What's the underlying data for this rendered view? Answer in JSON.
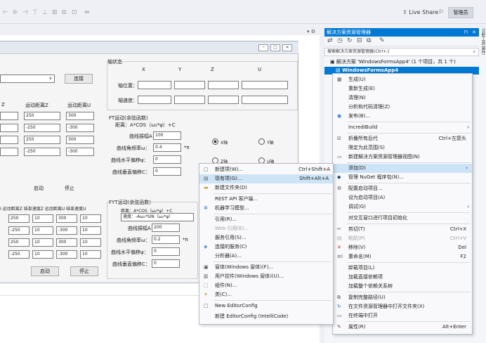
{
  "toolbar": {
    "icons": [
      "align-left-icon",
      "align-center-icon",
      "align-right-icon",
      "align-top-icon",
      "align-middle-icon",
      "align-bottom-icon",
      "same-size-icon",
      "grid-icon",
      "spacing-icon"
    ],
    "live_share": "Live Share",
    "admin": "管理员",
    "pin_icon": "pin-icon",
    "close_icon": "close-icon"
  },
  "form": {
    "connect_btn": "连接",
    "axis_state": "轴状态",
    "axis_cols": [
      "X",
      "Y",
      "Z",
      "U"
    ],
    "axis_pos": "轴位置：",
    "axis_speed": "轴速度：",
    "col_headers": [
      "Z",
      "运动距离Z",
      "运动距离U"
    ],
    "grid_values": [
      [
        "250",
        "300"
      ],
      [
        "-250",
        "-300"
      ],
      [
        "250",
        "300"
      ],
      [
        "-250",
        "-300"
      ]
    ],
    "start": "启动",
    "stop": "停止",
    "ft_title": "FT运动(余弦函数)",
    "ft_formula": "距离：A*COS（ω₂*ψ）+C",
    "ft_amp": "曲线振幅A：",
    "ft_amp_val": "100",
    "ft_freq": "曲线角频率ω：",
    "ft_freq_val": "0.4",
    "ft_pi": "*π",
    "ft_h": "曲线水平偏移ψ：",
    "ft_h_val": "0",
    "ft_v": "曲线垂直偏移C：",
    "ft_v_val": "0",
    "radio_x": "X轴",
    "radio_y": "Y轴",
    "radio_z": "Z轴",
    "radio_u": "U轴",
    "lower_headers": "I 运动距离Z 结束速度Z 运动距离U 结束速度U",
    "lower_rows": [
      [
        "250",
        "10",
        "300",
        "10"
      ],
      [
        "-250",
        "10",
        "-300",
        "10"
      ],
      [
        "250",
        "10",
        "300",
        "10"
      ],
      [
        "-250",
        "10",
        "-300",
        "10"
      ]
    ],
    "fyt_title": "FYT运动(余弦函数)",
    "fyt_dist": "距离：A*COS（ω₂*ψ）+C",
    "fyt_speed": "速度：-Aω₂*SIN（ω₂*ψ）",
    "fyt_amp_val": "200",
    "fyt_freq_val": "0.2",
    "fyt_h_val": "0",
    "fyt_v_val": "0"
  },
  "solution": {
    "title": "解决方案资源管理器",
    "search_placeholder": "搜索解决方案资源管理器(Ctrl+;)",
    "row1": "解决方案 'WindowsFormsApp4' (1 个项目，共 1 个)",
    "row2": "WindowsFormsApp4",
    "side_tabs": "诊断工具  属性"
  },
  "context_menu": {
    "items": [
      {
        "label": "生成(U)",
        "icon": "build-icon",
        "shortcut": ""
      },
      {
        "label": "重新生成(E)",
        "icon": "",
        "shortcut": ""
      },
      {
        "label": "清理(N)",
        "icon": "",
        "shortcut": ""
      },
      {
        "label": "分析和代码清理(Z)",
        "icon": "",
        "shortcut": ""
      },
      {
        "label": "发布(B)...",
        "icon": "globe-icon",
        "shortcut": ""
      },
      {
        "label": "IncrediBuild",
        "icon": "",
        "shortcut": ""
      },
      {
        "label": "折叠所有后代",
        "icon": "collapse-icon",
        "shortcut": "Ctrl+左箭头"
      },
      {
        "label": "限定为此范围(S)",
        "icon": "",
        "shortcut": ""
      },
      {
        "label": "新建解决方案资源管理器视图(N)",
        "icon": "new-view-icon",
        "shortcut": ""
      },
      {
        "label": "添加(D)",
        "icon": "",
        "shortcut": ""
      },
      {
        "label": "管理 NuGet 程序包(N)...",
        "icon": "nuget-icon",
        "shortcut": ""
      },
      {
        "label": "配置启动项目...",
        "icon": "gear-icon",
        "shortcut": ""
      },
      {
        "label": "设为启动项目(A)",
        "icon": "",
        "shortcut": ""
      },
      {
        "label": "调试(G)",
        "icon": "",
        "shortcut": ""
      },
      {
        "label": "对交互窗口进行项目初始化",
        "icon": "",
        "shortcut": ""
      },
      {
        "label": "剪切(T)",
        "icon": "cut-icon",
        "shortcut": "Ctrl+X"
      },
      {
        "label": "粘贴(P)",
        "icon": "paste-icon",
        "shortcut": "Ctrl+V"
      },
      {
        "label": "移除(V)",
        "icon": "remove-icon",
        "shortcut": "Del"
      },
      {
        "label": "重命名(M)",
        "icon": "rename-icon",
        "shortcut": "F2"
      },
      {
        "label": "卸载项目(L)",
        "icon": "",
        "shortcut": ""
      },
      {
        "label": "加载直接依赖项",
        "icon": "",
        "shortcut": ""
      },
      {
        "label": "加载整个依赖关系树",
        "icon": "",
        "shortcut": ""
      },
      {
        "label": "复制完整路径(U)",
        "icon": "copy-icon",
        "shortcut": ""
      },
      {
        "label": "在文件资源管理器中打开文件夹(X)",
        "icon": "open-folder-icon",
        "shortcut": ""
      },
      {
        "label": "在终端中打开",
        "icon": "terminal-icon",
        "shortcut": ""
      },
      {
        "label": "属性(R)",
        "icon": "wrench-icon",
        "shortcut": "Alt+Enter"
      }
    ]
  },
  "submenu": {
    "items": [
      {
        "label": "新建项(W)...",
        "icon": "new-item-icon",
        "shortcut": "Ctrl+Shift+A"
      },
      {
        "label": "现有项(G)...",
        "icon": "existing-item-icon",
        "shortcut": "Shift+Alt+A"
      },
      {
        "label": "新建文件夹(D)",
        "icon": "folder-icon",
        "shortcut": ""
      },
      {
        "label": "REST API 客户端...",
        "icon": "",
        "shortcut": ""
      },
      {
        "label": "机器学习模型...",
        "icon": "ml-icon",
        "shortcut": ""
      },
      {
        "label": "引用(R)...",
        "icon": "",
        "shortcut": ""
      },
      {
        "label": "Web 引用(E)...",
        "icon": "",
        "shortcut": ""
      },
      {
        "label": "服务引用(S)...",
        "icon": "",
        "shortcut": ""
      },
      {
        "label": "连接的服务(C)",
        "icon": "connected-service-icon",
        "shortcut": ""
      },
      {
        "label": "分析器(A)...",
        "icon": "",
        "shortcut": ""
      },
      {
        "label": "窗体(Windows 窗体)(F)...",
        "icon": "form-icon",
        "shortcut": ""
      },
      {
        "label": "用户控件(Windows 窗体)(U)...",
        "icon": "user-control-icon",
        "shortcut": ""
      },
      {
        "label": "组件(N)...",
        "icon": "component-icon",
        "shortcut": ""
      },
      {
        "label": "类(C)...",
        "icon": "class-icon",
        "shortcut": ""
      },
      {
        "label": "New EditorConfig",
        "icon": "editorconfig-icon",
        "shortcut": ""
      },
      {
        "label": "新建 EditorConfig (IntelliCode)",
        "icon": "",
        "shortcut": ""
      }
    ]
  }
}
